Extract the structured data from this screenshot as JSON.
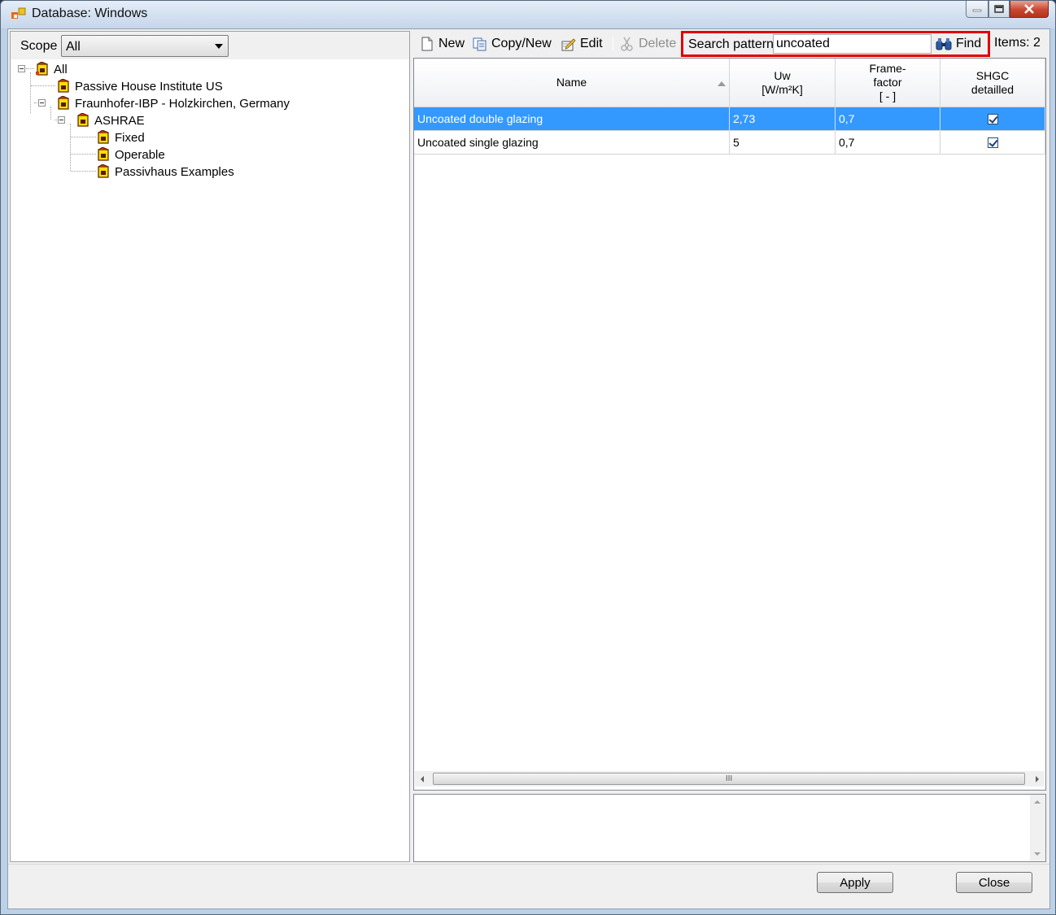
{
  "window": {
    "title": "Database: Windows"
  },
  "scope": {
    "label": "Scope",
    "selected": "All"
  },
  "tree": {
    "items": [
      {
        "label": "All"
      },
      {
        "label": "Passive House Institute US"
      },
      {
        "label": "Fraunhofer-IBP - Holzkirchen, Germany"
      },
      {
        "label": "ASHRAE"
      },
      {
        "label": "Fixed"
      },
      {
        "label": "Operable"
      },
      {
        "label": "Passivhaus Examples"
      }
    ]
  },
  "toolbar": {
    "new_label": "New",
    "copy_new_label": "Copy/New",
    "edit_label": "Edit",
    "delete_label": "Delete",
    "search_label": "Search pattern",
    "search_value": "uncoated",
    "find_label": "Find",
    "items_count": "Items: 2"
  },
  "grid": {
    "columns": [
      {
        "label": "Name"
      },
      {
        "label": "Uw\n[W/m²K]"
      },
      {
        "label": "Frame-\nfactor\n[ - ]"
      },
      {
        "label": "SHGC\ndetailled"
      }
    ],
    "rows": [
      {
        "name": "Uncoated double glazing",
        "uw": "2,73",
        "frame": "0,7",
        "shgc": true,
        "selected": true
      },
      {
        "name": "Uncoated single glazing",
        "uw": "5",
        "frame": "0,7",
        "shgc": true,
        "selected": false
      }
    ],
    "scroll_grip": "III"
  },
  "buttons": {
    "apply": "Apply",
    "close": "Close"
  },
  "colors": {
    "selection": "#3399ff",
    "highlight_border": "#e00000"
  }
}
